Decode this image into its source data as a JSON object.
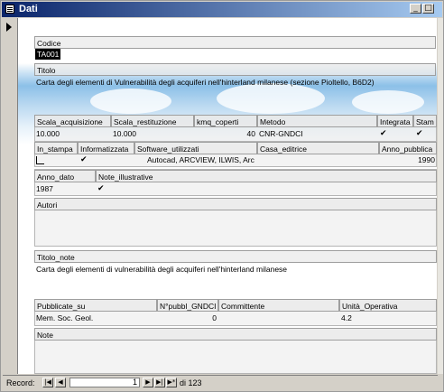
{
  "window": {
    "title": "Dati",
    "min_glyph": "_",
    "max_glyph": "□"
  },
  "fields": {
    "codice": {
      "label": "Codice",
      "value": "TA001"
    },
    "titolo": {
      "label": "Titolo",
      "value": "Carta degli elementi di Vulnerabilità degli acquiferi nell'hinterland milanese (sezione Pioltello, B6D2)"
    },
    "scala_acquisizione": {
      "label": "Scala_acquisizione",
      "value": "10.000"
    },
    "scala_restituzione": {
      "label": "Scala_restituzione",
      "value": "10.000"
    },
    "kmq_coperti": {
      "label": "kmq_coperti",
      "value": "40"
    },
    "metodo": {
      "label": "Metodo",
      "value": "CNR-GNDCI"
    },
    "integrata": {
      "label": "Integrata",
      "checked": true
    },
    "stam": {
      "label": "Stam",
      "checked": true
    },
    "in_stampa": {
      "label": "In_stampa",
      "checked": false
    },
    "informatizzata": {
      "label": "Informatizzata",
      "checked": true
    },
    "software_utilizzati": {
      "label": "Software_utilizzati",
      "value": "Autocad, ARCVIEW, ILWIS, Arc"
    },
    "casa_editrice": {
      "label": "Casa_editrice",
      "value": ""
    },
    "anno_pubblica": {
      "label": "Anno_pubblica",
      "value": "1990"
    },
    "anno_dato": {
      "label": "Anno_dato",
      "value": "1987"
    },
    "note_illustrative": {
      "label": "Note_illustrative",
      "checked": true
    },
    "autori": {
      "label": "Autori",
      "value": ""
    },
    "titolo_note": {
      "label": "Titolo_note",
      "value": "Carta degli elementi di vulnerabilità degli acquiferi nell'hinterland milanese"
    },
    "pubblicate_su": {
      "label": "Pubblicate_su",
      "value": "Mem. Soc. Geol."
    },
    "npubbli_gndci": {
      "label": "N°pubbl_GNDCI",
      "value": "0"
    },
    "committente": {
      "label": "Committente",
      "value": ""
    },
    "unita_operativa": {
      "label": "Unità_Operativa",
      "value": "4.2"
    },
    "note": {
      "label": "Note",
      "value": ""
    }
  },
  "check_glyph": "✔",
  "navigation": {
    "record_label": "Record:",
    "current": "1",
    "of_text": "di 123"
  },
  "colors": {
    "titlebar": "#0a246a",
    "chrome": "#d4d0c8",
    "selected_value_bg": "#000000"
  }
}
